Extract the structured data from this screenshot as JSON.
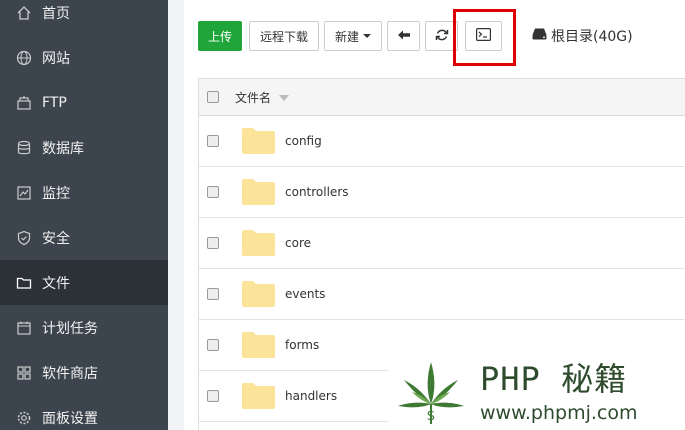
{
  "sidebar": {
    "items": [
      {
        "label": "首页",
        "icon": "home-icon"
      },
      {
        "label": "网站",
        "icon": "globe-icon"
      },
      {
        "label": "FTP",
        "icon": "ftp-icon"
      },
      {
        "label": "数据库",
        "icon": "database-icon"
      },
      {
        "label": "监控",
        "icon": "monitor-icon"
      },
      {
        "label": "安全",
        "icon": "shield-icon"
      },
      {
        "label": "文件",
        "icon": "folder-icon",
        "active": true
      },
      {
        "label": "计划任务",
        "icon": "calendar-icon"
      },
      {
        "label": "软件商店",
        "icon": "grid-icon"
      },
      {
        "label": "面板设置",
        "icon": "gear-icon"
      }
    ]
  },
  "toolbar": {
    "upload_label": "上传",
    "remote_download_label": "远程下载",
    "new_label": "新建",
    "disk_label": "根目录(40G)"
  },
  "table": {
    "header_label": "文件名",
    "rows": [
      "config",
      "controllers",
      "core",
      "events",
      "forms",
      "handlers"
    ]
  },
  "watermark": {
    "title": "PHP 秘籍",
    "url": "www.phpmj.com"
  },
  "colors": {
    "sidebar_bg": "#3c444d",
    "sidebar_active_bg": "#2c3138",
    "primary": "#20a53a",
    "highlight": "#e10000",
    "folder": "#fbe49a"
  }
}
